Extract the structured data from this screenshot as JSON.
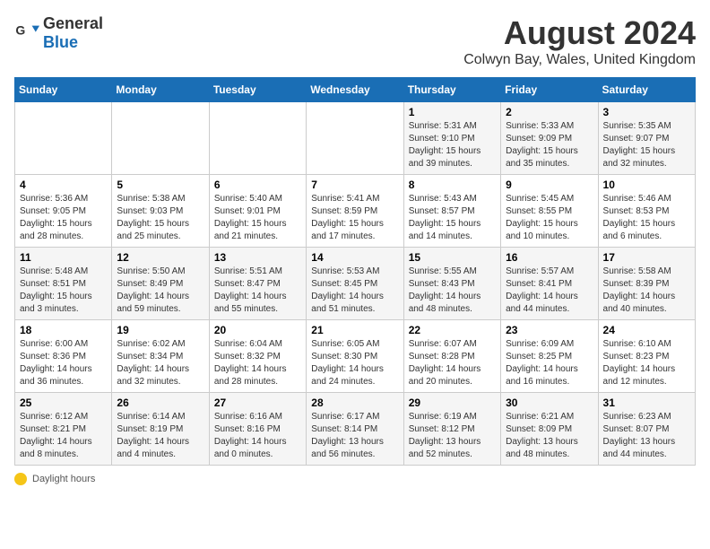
{
  "header": {
    "logo_general": "General",
    "logo_blue": "Blue",
    "month_title": "August 2024",
    "location": "Colwyn Bay, Wales, United Kingdom"
  },
  "weekdays": [
    "Sunday",
    "Monday",
    "Tuesday",
    "Wednesday",
    "Thursday",
    "Friday",
    "Saturday"
  ],
  "weeks": [
    [
      {
        "day": "",
        "info": ""
      },
      {
        "day": "",
        "info": ""
      },
      {
        "day": "",
        "info": ""
      },
      {
        "day": "",
        "info": ""
      },
      {
        "day": "1",
        "info": "Sunrise: 5:31 AM\nSunset: 9:10 PM\nDaylight: 15 hours\nand 39 minutes."
      },
      {
        "day": "2",
        "info": "Sunrise: 5:33 AM\nSunset: 9:09 PM\nDaylight: 15 hours\nand 35 minutes."
      },
      {
        "day": "3",
        "info": "Sunrise: 5:35 AM\nSunset: 9:07 PM\nDaylight: 15 hours\nand 32 minutes."
      }
    ],
    [
      {
        "day": "4",
        "info": "Sunrise: 5:36 AM\nSunset: 9:05 PM\nDaylight: 15 hours\nand 28 minutes."
      },
      {
        "day": "5",
        "info": "Sunrise: 5:38 AM\nSunset: 9:03 PM\nDaylight: 15 hours\nand 25 minutes."
      },
      {
        "day": "6",
        "info": "Sunrise: 5:40 AM\nSunset: 9:01 PM\nDaylight: 15 hours\nand 21 minutes."
      },
      {
        "day": "7",
        "info": "Sunrise: 5:41 AM\nSunset: 8:59 PM\nDaylight: 15 hours\nand 17 minutes."
      },
      {
        "day": "8",
        "info": "Sunrise: 5:43 AM\nSunset: 8:57 PM\nDaylight: 15 hours\nand 14 minutes."
      },
      {
        "day": "9",
        "info": "Sunrise: 5:45 AM\nSunset: 8:55 PM\nDaylight: 15 hours\nand 10 minutes."
      },
      {
        "day": "10",
        "info": "Sunrise: 5:46 AM\nSunset: 8:53 PM\nDaylight: 15 hours\nand 6 minutes."
      }
    ],
    [
      {
        "day": "11",
        "info": "Sunrise: 5:48 AM\nSunset: 8:51 PM\nDaylight: 15 hours\nand 3 minutes."
      },
      {
        "day": "12",
        "info": "Sunrise: 5:50 AM\nSunset: 8:49 PM\nDaylight: 14 hours\nand 59 minutes."
      },
      {
        "day": "13",
        "info": "Sunrise: 5:51 AM\nSunset: 8:47 PM\nDaylight: 14 hours\nand 55 minutes."
      },
      {
        "day": "14",
        "info": "Sunrise: 5:53 AM\nSunset: 8:45 PM\nDaylight: 14 hours\nand 51 minutes."
      },
      {
        "day": "15",
        "info": "Sunrise: 5:55 AM\nSunset: 8:43 PM\nDaylight: 14 hours\nand 48 minutes."
      },
      {
        "day": "16",
        "info": "Sunrise: 5:57 AM\nSunset: 8:41 PM\nDaylight: 14 hours\nand 44 minutes."
      },
      {
        "day": "17",
        "info": "Sunrise: 5:58 AM\nSunset: 8:39 PM\nDaylight: 14 hours\nand 40 minutes."
      }
    ],
    [
      {
        "day": "18",
        "info": "Sunrise: 6:00 AM\nSunset: 8:36 PM\nDaylight: 14 hours\nand 36 minutes."
      },
      {
        "day": "19",
        "info": "Sunrise: 6:02 AM\nSunset: 8:34 PM\nDaylight: 14 hours\nand 32 minutes."
      },
      {
        "day": "20",
        "info": "Sunrise: 6:04 AM\nSunset: 8:32 PM\nDaylight: 14 hours\nand 28 minutes."
      },
      {
        "day": "21",
        "info": "Sunrise: 6:05 AM\nSunset: 8:30 PM\nDaylight: 14 hours\nand 24 minutes."
      },
      {
        "day": "22",
        "info": "Sunrise: 6:07 AM\nSunset: 8:28 PM\nDaylight: 14 hours\nand 20 minutes."
      },
      {
        "day": "23",
        "info": "Sunrise: 6:09 AM\nSunset: 8:25 PM\nDaylight: 14 hours\nand 16 minutes."
      },
      {
        "day": "24",
        "info": "Sunrise: 6:10 AM\nSunset: 8:23 PM\nDaylight: 14 hours\nand 12 minutes."
      }
    ],
    [
      {
        "day": "25",
        "info": "Sunrise: 6:12 AM\nSunset: 8:21 PM\nDaylight: 14 hours\nand 8 minutes."
      },
      {
        "day": "26",
        "info": "Sunrise: 6:14 AM\nSunset: 8:19 PM\nDaylight: 14 hours\nand 4 minutes."
      },
      {
        "day": "27",
        "info": "Sunrise: 6:16 AM\nSunset: 8:16 PM\nDaylight: 14 hours\nand 0 minutes."
      },
      {
        "day": "28",
        "info": "Sunrise: 6:17 AM\nSunset: 8:14 PM\nDaylight: 13 hours\nand 56 minutes."
      },
      {
        "day": "29",
        "info": "Sunrise: 6:19 AM\nSunset: 8:12 PM\nDaylight: 13 hours\nand 52 minutes."
      },
      {
        "day": "30",
        "info": "Sunrise: 6:21 AM\nSunset: 8:09 PM\nDaylight: 13 hours\nand 48 minutes."
      },
      {
        "day": "31",
        "info": "Sunrise: 6:23 AM\nSunset: 8:07 PM\nDaylight: 13 hours\nand 44 minutes."
      }
    ]
  ],
  "footer": {
    "legend_label": "Daylight hours"
  }
}
